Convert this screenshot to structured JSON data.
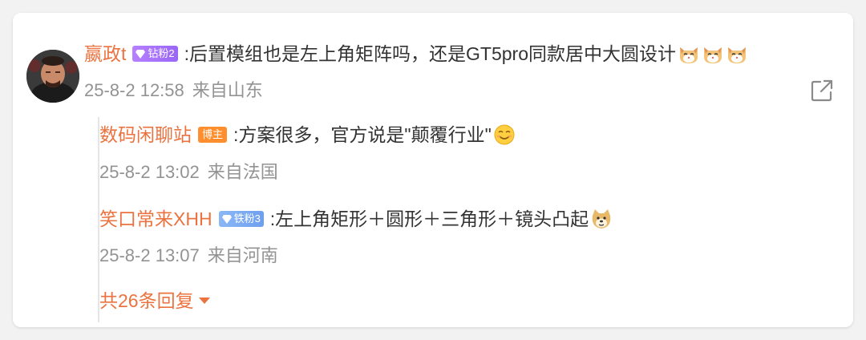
{
  "comment": {
    "username": "嬴政t",
    "badge": "钻粉2",
    "text": ":后置模组也是左上角矩阵吗，还是GT5pro同款居中大圆设计",
    "emojis": [
      "cat-emoji",
      "cat-emoji",
      "cat-emoji"
    ],
    "date": "25-8-2 12:58",
    "location": "来自山东"
  },
  "replies": [
    {
      "username": "数码闲聊站",
      "badge": "博主",
      "text": ":方案很多，官方说是\"颠覆行业\"",
      "emoji": "smile-emoji",
      "date": "25-8-2 13:02",
      "location": "来自法国"
    },
    {
      "username": "笑口常来XHH",
      "badge": "铁粉3",
      "text": ":左上角矩形＋圆形＋三角形＋镜头凸起",
      "emoji": "doge-emoji",
      "date": "25-8-2 13:07",
      "location": "来自河南"
    }
  ],
  "more_replies": "共26条回复",
  "colors": {
    "username": "#eb7340",
    "meta": "#939393",
    "badge_purple": "#a874f9",
    "badge_orange": "#ff8f2e",
    "badge_blue": "#7aaaf2"
  }
}
